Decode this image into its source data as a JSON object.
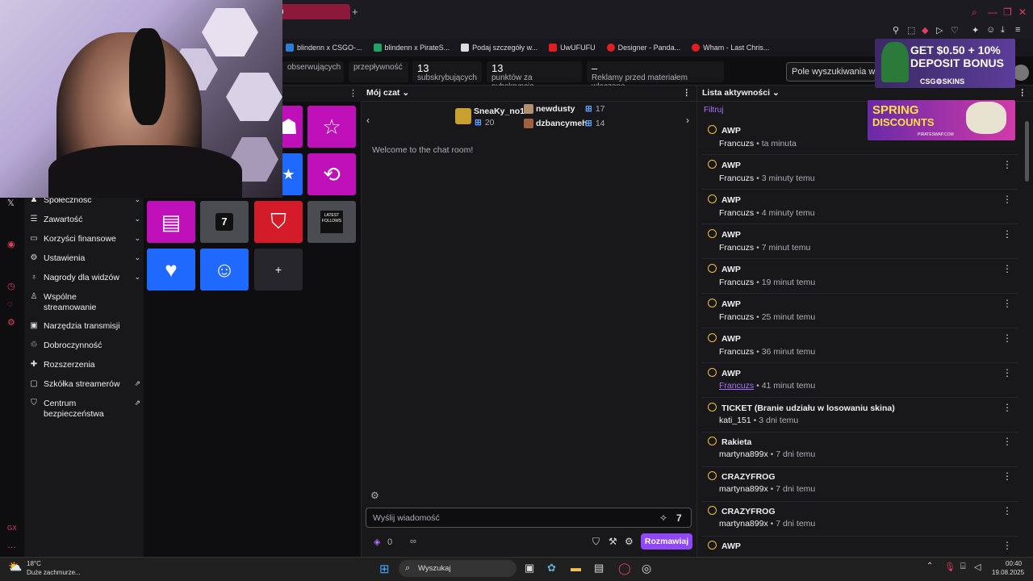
{
  "browser": {
    "active_tab": "h",
    "new_tab": "+",
    "bookmarks": [
      {
        "label": "blindenn x CSGO-...",
        "color": "#2d7dd2"
      },
      {
        "label": "blindenn x PirateS...",
        "color": "#1fa463"
      },
      {
        "label": "Podaj szczegóły w...",
        "color": "#dddddd"
      },
      {
        "label": "UwUFUFU",
        "color": "#e02020"
      },
      {
        "label": "Designer - Panda...",
        "color": "#e02020"
      },
      {
        "label": "Wham - Last Chris...",
        "color": "#e02020"
      }
    ]
  },
  "stats": [
    {
      "value": "",
      "label": "obserwujących"
    },
    {
      "value": "",
      "label": "przepływność"
    },
    {
      "value": "13",
      "label": "subskrybujących"
    },
    {
      "value": "13",
      "label": "punktów za subskrypcje"
    },
    {
      "value": "–",
      "label": "Reklamy przed materiałem włączone"
    }
  ],
  "search_placeholder": "Pole wyszukiwania w pa",
  "sidebar": {
    "items": [
      {
        "label": "Społeczność",
        "icon": "people-icon",
        "chevron": true
      },
      {
        "label": "Zawartość",
        "icon": "content-icon",
        "chevron": true
      },
      {
        "label": "Korzyści finansowe",
        "icon": "money-icon",
        "chevron": true
      },
      {
        "label": "Ustawienia",
        "icon": "gear-icon",
        "chevron": true
      },
      {
        "label": "Nagrody dla widzów",
        "icon": "reward-icon",
        "chevron": true
      },
      {
        "label": "Wspólne streamowanie",
        "icon": "collab-icon",
        "chevron": false
      },
      {
        "label": "Narzędzia transmisji",
        "icon": "camera-icon",
        "chevron": false
      },
      {
        "label": "Dobroczynność",
        "icon": "charity-icon",
        "chevron": false
      },
      {
        "label": "Rozszerzenia",
        "icon": "extensions-icon",
        "chevron": false
      },
      {
        "label": "Szkółka streamerów",
        "icon": "school-icon",
        "chevron": false,
        "external": true
      },
      {
        "label": "Centrum bezpieczeństwa",
        "icon": "shield-icon",
        "chevron": false,
        "external": true
      }
    ]
  },
  "quick_actions": {
    "add_label": "+",
    "tiles": [
      {
        "name": "unknown-purple-tile",
        "icon": "tag-icon",
        "color": "#bf0fb9",
        "glyph": "☗"
      },
      {
        "name": "star-tile",
        "icon": "star-icon",
        "color": "#bf0fb9",
        "glyph": "☆"
      },
      {
        "name": "blue-tile",
        "icon": "star-icon",
        "color": "#1f69ff",
        "glyph": "★"
      },
      {
        "name": "clip-tile",
        "icon": "clip-icon",
        "color": "#bf0fb9",
        "glyph": "⟲"
      },
      {
        "name": "layout-tile",
        "icon": "layout-icon",
        "color": "#bf0fb9",
        "glyph": "▤"
      },
      {
        "name": "7tv-tile",
        "icon": "7tv-icon",
        "color": "#4b4b52",
        "glyph": "7"
      },
      {
        "name": "shield-tile",
        "icon": "shield-icon",
        "color": "#d31b2a",
        "glyph": "⛉"
      },
      {
        "name": "latest-follows-tile",
        "icon": "latest-follows-icon",
        "color": "#4b4b52",
        "glyph": "LATEST FOLLOWS"
      },
      {
        "name": "heart-tile",
        "icon": "heart-icon",
        "color": "#1f69ff",
        "glyph": "♥"
      },
      {
        "name": "smile-tile",
        "icon": "smile-icon",
        "color": "#1f69ff",
        "glyph": "☺"
      }
    ]
  },
  "chat": {
    "header": "Mój czat",
    "gifters": [
      {
        "name": "SneaKy_no1",
        "count": "20"
      },
      {
        "name": "newdusty",
        "count": "17"
      },
      {
        "name": "dzbancymeh",
        "count": "14"
      }
    ],
    "welcome": "Welcome to the chat room!",
    "input_placeholder": "Wyślij wiadomość",
    "points": "0",
    "infinity": "∞",
    "send_label": "Rozmawiaj"
  },
  "activity": {
    "header": "Lista aktywności",
    "filter": "Filtruj",
    "items": [
      {
        "title": "AWP",
        "user": "Francuzs",
        "time": "ta minuta"
      },
      {
        "title": "AWP",
        "user": "Francuzs",
        "time": "3 minuty temu"
      },
      {
        "title": "AWP",
        "user": "Francuzs",
        "time": "4 minuty temu"
      },
      {
        "title": "AWP",
        "user": "Francuzs",
        "time": "7 minut temu"
      },
      {
        "title": "AWP",
        "user": "Francuzs",
        "time": "19 minut temu"
      },
      {
        "title": "AWP",
        "user": "Francuzs",
        "time": "25 minut temu"
      },
      {
        "title": "AWP",
        "user": "Francuzs",
        "time": "36 minut temu"
      },
      {
        "title": "AWP",
        "user": "Francuzs",
        "time": "41 minut temu",
        "hover": true
      },
      {
        "title": "TICKET (Branie udziału w losowaniu skina)",
        "user": "kati_151",
        "time": "3 dni temu"
      },
      {
        "title": "Rakieta",
        "user": "martyna899x",
        "time": "7 dni temu"
      },
      {
        "title": "CRAZYFROG",
        "user": "martyna899x",
        "time": "7 dni temu"
      },
      {
        "title": "CRAZYFROG",
        "user": "martyna899x",
        "time": "7 dni temu"
      },
      {
        "title": "AWP",
        "user": "",
        "time": ""
      }
    ]
  },
  "ads": {
    "csgo": {
      "line1": "GET $0.50 + 10%",
      "line2": "DEPOSIT BONUS",
      "brand": "CSG⚙SKINS"
    },
    "pirate": {
      "line1": "SPRING",
      "line2": "DISCOUNTS",
      "brand": "PIRATESWAP.COM"
    }
  },
  "taskbar": {
    "weather_temp": "18°C",
    "weather_desc": "Duże zachmurze...",
    "search": "Wyszukaj",
    "time": "00:40",
    "date": "19.08.2025"
  }
}
